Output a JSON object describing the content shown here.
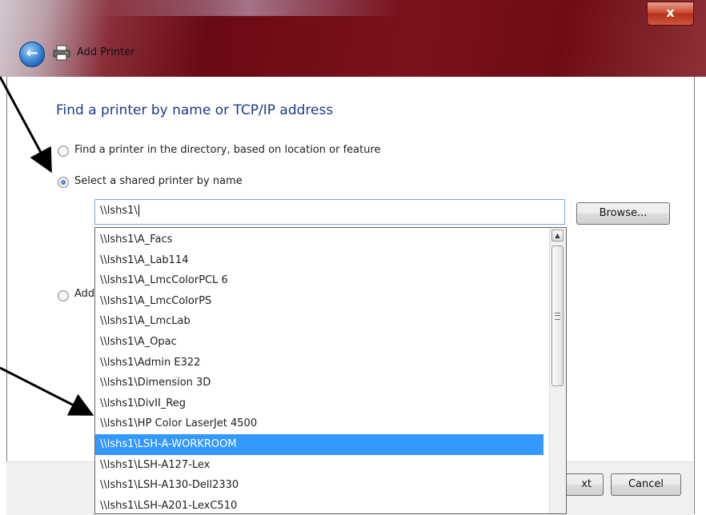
{
  "window": {
    "title": "Add Printer",
    "close_label": "x"
  },
  "heading": "Find a printer by name or TCP/IP address",
  "options": [
    {
      "label": "Find a printer in the directory, based on location or feature",
      "checked": false
    },
    {
      "label": "Select a shared printer by name",
      "checked": true
    },
    {
      "label": "Add",
      "checked": false
    }
  ],
  "printer_name": {
    "value": "\\\\lshs1\\"
  },
  "browse_label": "Browse...",
  "suggestions": [
    "\\\\lshs1\\A_Facs",
    "\\\\lshs1\\A_Lab114",
    "\\\\lshs1\\A_LmcColorPCL 6",
    "\\\\lshs1\\A_LmcColorPS",
    "\\\\lshs1\\A_LmcLab",
    "\\\\lshs1\\A_Opac",
    "\\\\lshs1\\Admin E322",
    "\\\\lshs1\\Dimension 3D",
    "\\\\lshs1\\DivII_Reg",
    "\\\\lshs1\\HP Color LaserJet 4500",
    "\\\\lshs1\\LSH-A-WORKROOM",
    "\\\\lshs1\\LSH-A127-Lex",
    "\\\\lshs1\\LSH-A130-Dell2330",
    "\\\\lshs1\\LSH-A201-LexC510"
  ],
  "selected_index": 10,
  "footer": {
    "next_label": "xt",
    "cancel_label": "Cancel"
  },
  "icons": {
    "back": "back-arrow-icon",
    "printer": "printer-icon",
    "scroll_up": "scroll-up-arrow-icon",
    "scroll_grip": "scroll-grip-icon"
  },
  "colors": {
    "heading": "#1d3a8a",
    "selection": "#3399ff",
    "titlebar": "#6a0a14"
  }
}
